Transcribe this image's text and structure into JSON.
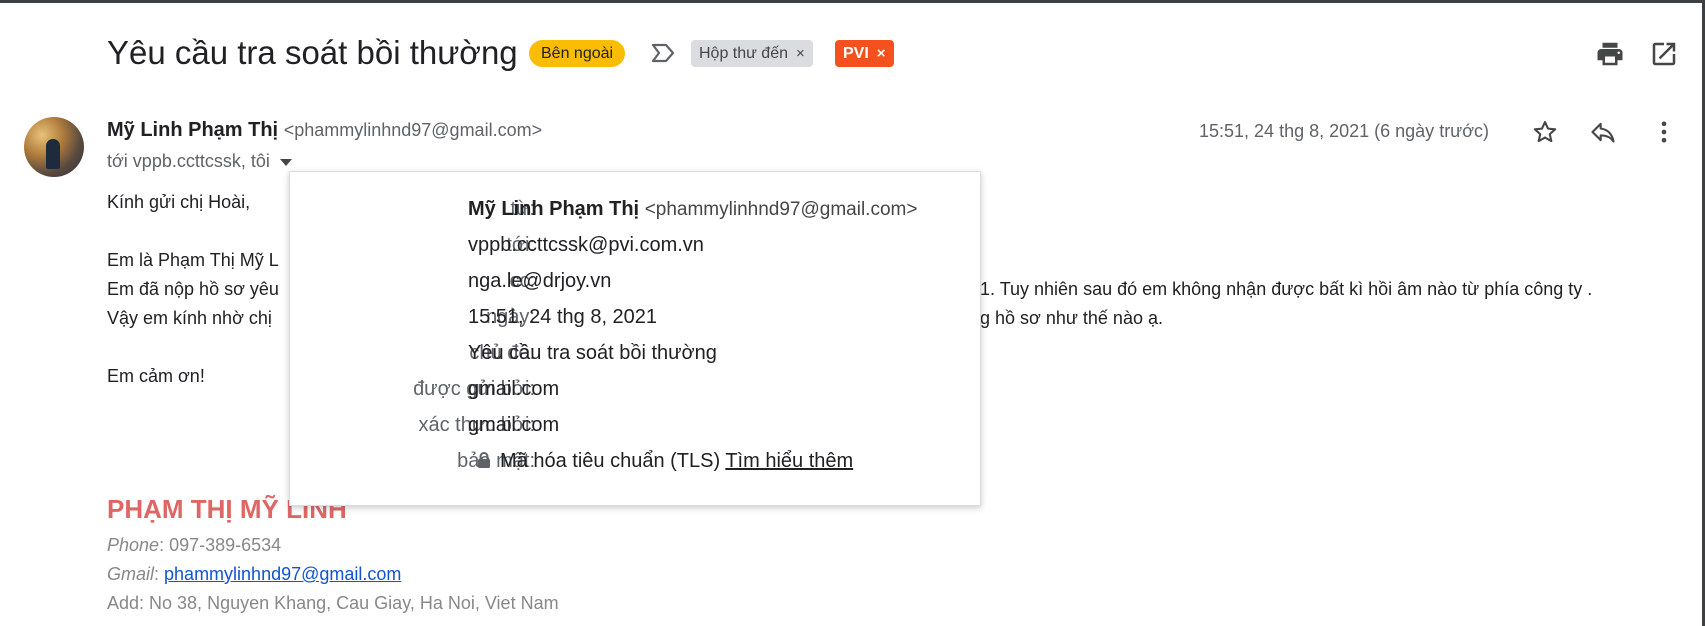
{
  "message": {
    "subject": "Yêu cầu tra soát bồi thường",
    "external_chip": "Bên ngoài",
    "labels": [
      {
        "text": "Hộp thư đến",
        "remove": "×"
      },
      {
        "text": "PVI",
        "remove": "×"
      }
    ],
    "sender_name": "Mỹ Linh Phạm Thị",
    "sender_email": "<phammylinhnd97@gmail.com>",
    "recipients": "tới vppb.ccttcssk, tôi",
    "date": "15:51, 24 thg 8, 2021 (6 ngày trước)"
  },
  "icons": {
    "important": "important-marker-icon",
    "print": "print-icon",
    "open_new": "open-in-new-window-icon",
    "star": "star-icon",
    "reply": "reply-icon",
    "more": "more-vert-icon",
    "lock": "lock-icon"
  },
  "body": {
    "greeting": "Kính gửi chị Hoài,",
    "line2": "Em là Phạm Thị Mỹ L",
    "line3_left": "Em đã nộp hồ sơ yêu",
    "line3_right": "1. Tuy nhiên sau đó em không nhận được bất kì hồi âm nào từ phía công ty .",
    "line4_left": "Vậy em kính nhờ chị",
    "line4_right": "g hồ sơ như thế nào ạ.",
    "thanks": "Em cảm ơn!"
  },
  "signature": {
    "name": "PHẠM THỊ MỸ LINH",
    "phone_label": "Phone",
    "phone": ": 097-389-6534",
    "gmail_label": "Gmail",
    "gmail_sep": ": ",
    "gmail": "phammylinhnd97@gmail.com",
    "address": "Add: No 38, Nguyen Khang, Cau Giay, Ha Noi, Viet Nam"
  },
  "details_popup": {
    "rows": [
      {
        "key": "từ:",
        "name": "Mỹ Linh Phạm Thị",
        "email": "<phammylinhnd97@gmail.com>"
      },
      {
        "key": "tới:",
        "value": "vppb.ccttcssk@pvi.com.vn"
      },
      {
        "key": "cc:",
        "value": "nga.le@drjoy.vn"
      },
      {
        "key": "ngày:",
        "value": "15:51, 24 thg 8, 2021"
      },
      {
        "key": "chủ đề:",
        "value": "Yêu cầu tra soát bồi thường"
      },
      {
        "key": "được gửi bởi:",
        "value": "gmail.com"
      },
      {
        "key": "xác thực bởi:",
        "value": "gmail.com"
      },
      {
        "key": "bảo mật:",
        "value": "Mã hóa tiêu chuẩn (TLS)",
        "link": "Tìm hiểu thêm"
      }
    ]
  },
  "colors": {
    "external_chip": "#fbbc04",
    "pvi_label": "#f4511e",
    "inbox_label": "#dadce0",
    "signature_name": "#e06666",
    "link": "#1155cc"
  }
}
